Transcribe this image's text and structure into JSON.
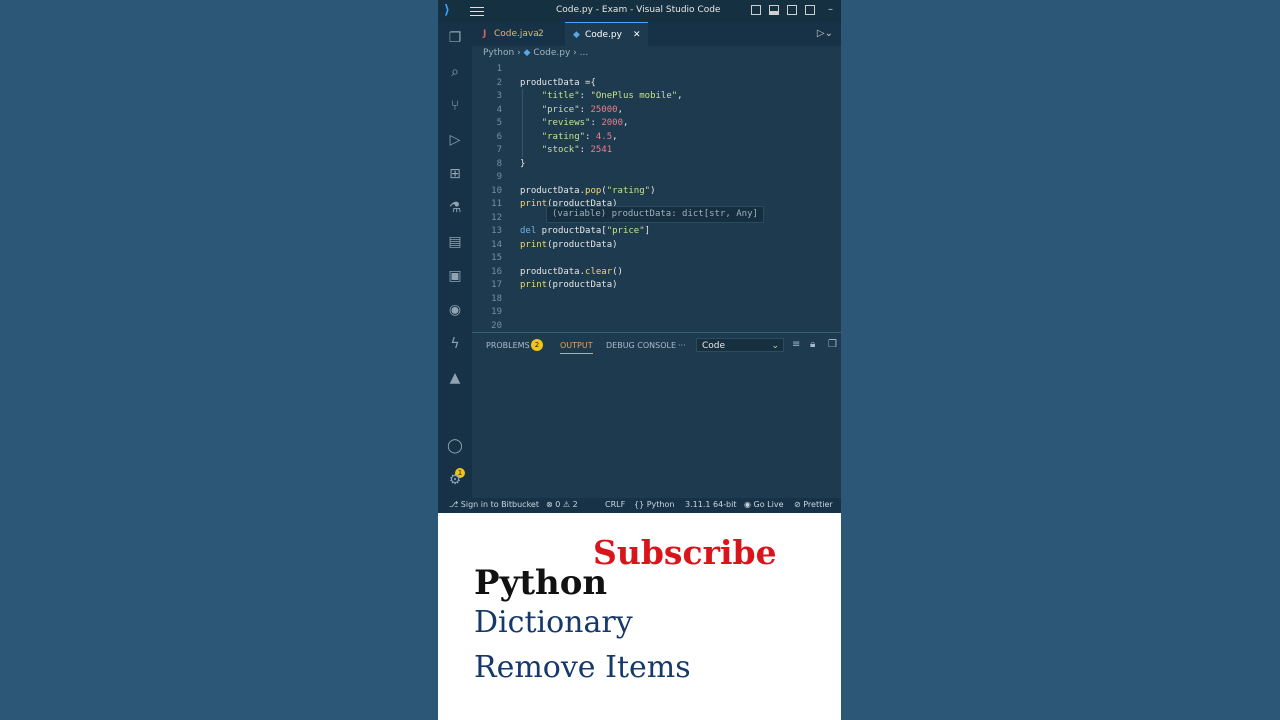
{
  "window": {
    "title": "Code.py - Exam - Visual Studio Code",
    "minimize": "–"
  },
  "tabs": [
    {
      "label": "Code.java",
      "badge": "2",
      "glyph": "J"
    },
    {
      "label": "Code.py",
      "close": "✕"
    }
  ],
  "breadcrumb": {
    "folder": "Python",
    "file": "Code.py",
    "more": "..."
  },
  "editor": {
    "line_numbers": [
      "1",
      "2",
      "3",
      "4",
      "5",
      "6",
      "7",
      "8",
      "9",
      "10",
      "11",
      "12",
      "13",
      "14",
      "15",
      "16",
      "17",
      "18",
      "19",
      "20"
    ],
    "lines": [
      "",
      "productData ={",
      "    \"title\": \"OnePlus mobile\",",
      "    \"price\": 25000,",
      "    \"reviews\": 2000,",
      "    \"rating\": 4.5,",
      "    \"stock\": 2541",
      "}",
      "",
      "productData.pop(\"rating\")",
      "print(productData)",
      "",
      "del productData[\"price\"]",
      "print(productData)",
      "",
      "productData.clear()",
      "print(productData)",
      "",
      "",
      ""
    ],
    "hover_text": "(variable) productData: dict[str, Any]"
  },
  "panel": {
    "tabs": [
      "PROBLEMS",
      "OUTPUT",
      "DEBUG CONSOLE"
    ],
    "problems_count": "2",
    "more": "···",
    "active_tab": "OUTPUT",
    "output_channel": "Code"
  },
  "activity": {
    "account_badge": "1"
  },
  "status_bar": {
    "bitbucket": "Sign in to Bitbucket",
    "errors": "0",
    "warnings": "2",
    "eol": "CRLF",
    "language": "Python",
    "interpreter": "3.11.1 64-bit",
    "go_live": "Go Live",
    "prettier": "Prettier"
  },
  "promo": {
    "subscribe": "Subscribe",
    "title": "Python",
    "subtitle1": "Dictionary",
    "subtitle2": "Remove Items"
  },
  "colors": {
    "accent_blue": "#4fa3ff",
    "badge_yellow": "#f0c419",
    "subscribe_red": "#d9141a",
    "subtitle_blue": "#16386a"
  }
}
